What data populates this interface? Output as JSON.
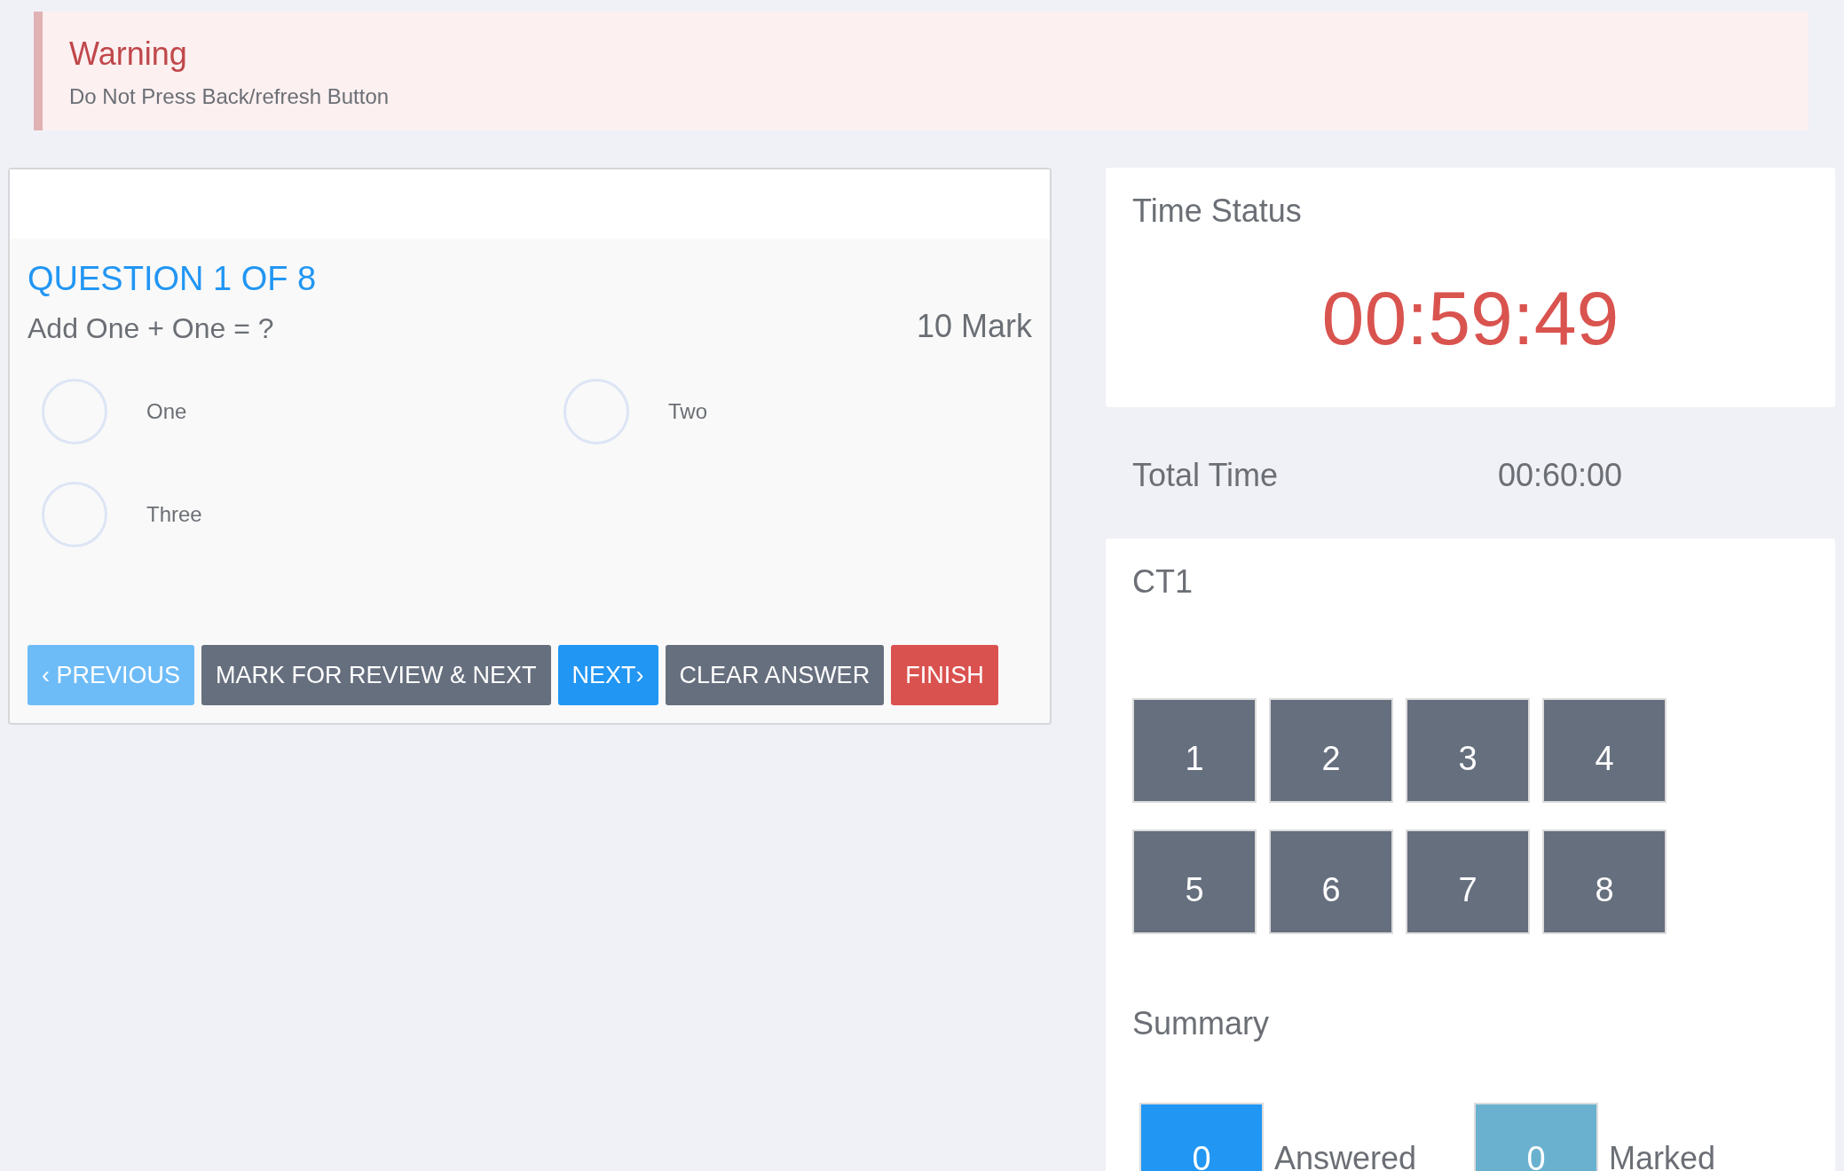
{
  "alert": {
    "title": "Warning",
    "message": "Do Not Press Back/refresh Button"
  },
  "question": {
    "heading": "QUESTION 1 OF 8",
    "text": "Add One + One = ?",
    "marks": "10 Mark",
    "options": [
      {
        "label": "One",
        "selected": false
      },
      {
        "label": "Two",
        "selected": false
      },
      {
        "label": "Three",
        "selected": false
      }
    ],
    "buttons": [
      {
        "label": "‹ PREVIOUS",
        "kind": "light"
      },
      {
        "label": "MARK FOR REVIEW & NEXT",
        "kind": "dark"
      },
      {
        "label": "NEXT›",
        "kind": "primary"
      },
      {
        "label": "CLEAR ANSWER",
        "kind": "dark"
      },
      {
        "label": "FINISH",
        "kind": "danger"
      }
    ]
  },
  "time_status": {
    "title": "Time Status",
    "remaining": "00:59:49"
  },
  "total_time": {
    "label": "Total Time",
    "value": "00:60:00"
  },
  "palette": {
    "title": "CT1",
    "questions": [
      "1",
      "2",
      "3",
      "4",
      "5",
      "6",
      "7",
      "8"
    ]
  },
  "summary": {
    "title": "Summary",
    "items": [
      {
        "count": "0",
        "label": "Answered",
        "color": "#2196f3"
      },
      {
        "count": "0",
        "label": "Marked",
        "color": "#69b1cf"
      }
    ]
  }
}
